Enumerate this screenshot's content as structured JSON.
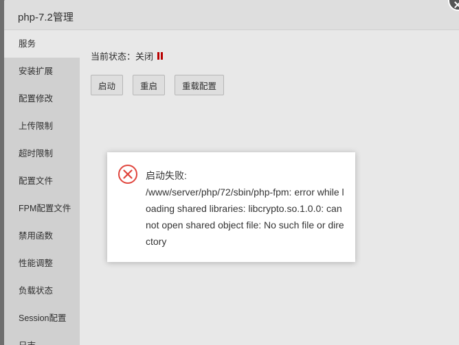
{
  "window": {
    "title": "php-7.2管理"
  },
  "sidebar": {
    "items": [
      {
        "label": "服务",
        "active": true
      },
      {
        "label": "安装扩展"
      },
      {
        "label": "配置修改"
      },
      {
        "label": "上传限制"
      },
      {
        "label": "超时限制"
      },
      {
        "label": "配置文件"
      },
      {
        "label": "FPM配置文件"
      },
      {
        "label": "禁用函数"
      },
      {
        "label": "性能调整"
      },
      {
        "label": "负载状态"
      },
      {
        "label": "Session配置"
      },
      {
        "label": "日志"
      }
    ]
  },
  "service": {
    "status_label": "当前状态：关闭",
    "status_icon": "pause-icon",
    "status_color": "#cc0000",
    "buttons": {
      "start": "启动",
      "restart": "重启",
      "reload": "重载配置"
    }
  },
  "error_toast": {
    "icon": "error-circle-icon",
    "icon_color": "#e0443c",
    "title": "启动失败:",
    "message": "/www/server/php/72/sbin/php-fpm: error while loading shared libraries: libcrypto.so.1.0.0: cannot open shared object file: No such file or directory"
  }
}
